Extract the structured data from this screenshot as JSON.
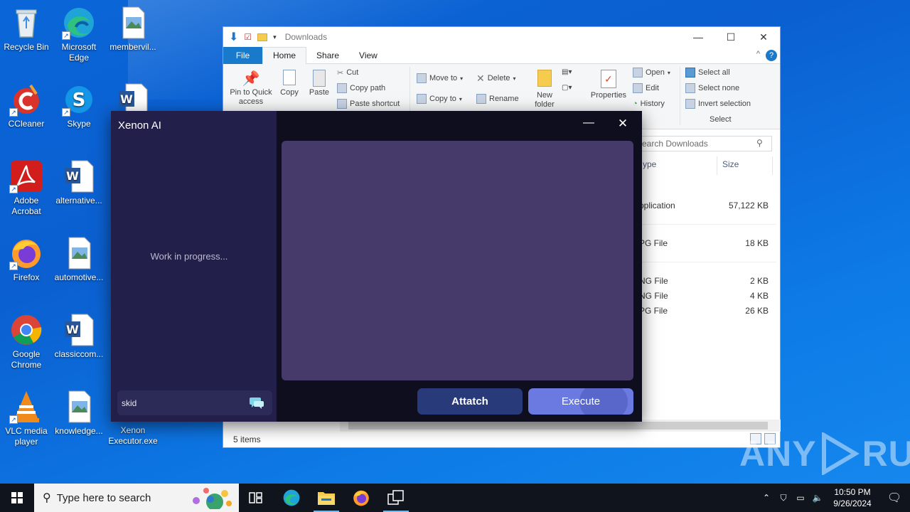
{
  "desktop": {
    "icons": [
      {
        "label": "Recycle Bin",
        "icon": "recycle-bin-icon"
      },
      {
        "label": "Microsoft Edge",
        "icon": "edge-icon"
      },
      {
        "label": "membervil...",
        "icon": "image-file-icon"
      },
      {
        "label": "CCleaner",
        "icon": "ccleaner-icon"
      },
      {
        "label": "Skype",
        "icon": "skype-icon"
      },
      {
        "label": "Adobe Acrobat",
        "icon": "acrobat-icon"
      },
      {
        "label": "alternative...",
        "icon": "word-doc-icon"
      },
      {
        "label": "Firefox",
        "icon": "firefox-icon"
      },
      {
        "label": "automotive...",
        "icon": "image-file-icon"
      },
      {
        "label": "Google Chrome",
        "icon": "chrome-icon"
      },
      {
        "label": "classiccom...",
        "icon": "word-doc-icon"
      },
      {
        "label": "VLC media player",
        "icon": "vlc-icon"
      },
      {
        "label": "knowledge...",
        "icon": "image-file-icon"
      },
      {
        "label": "Xenon Executor.exe",
        "icon": "exe-icon"
      }
    ]
  },
  "explorer": {
    "title": "Downloads",
    "tabs": {
      "file": "File",
      "home": "Home",
      "share": "Share",
      "view": "View"
    },
    "ribbon": {
      "pin": "Pin to Quick access",
      "copy": "Copy",
      "paste": "Paste",
      "cut": "Cut",
      "copy_path": "Copy path",
      "paste_shortcut": "Paste shortcut",
      "move_to": "Move to",
      "copy_to": "Copy to",
      "delete": "Delete",
      "rename": "Rename",
      "new_folder": "New folder",
      "properties": "Properties",
      "open": "Open",
      "edit": "Edit",
      "history": "History",
      "select_all": "Select all",
      "select_none": "Select none",
      "invert_selection": "Invert selection",
      "select_group": "Select"
    },
    "search_placeholder": "earch Downloads",
    "columns": {
      "type": "ype",
      "size": "Size"
    },
    "files": [
      {
        "type": "pplication",
        "size": "57,122 KB"
      },
      {
        "type": "PG File",
        "size": "18 KB"
      },
      {
        "type": "NG File",
        "size": "2 KB"
      },
      {
        "type": "NG File",
        "size": "4 KB"
      },
      {
        "type": "PG File",
        "size": "26 KB"
      }
    ],
    "status": "5 items"
  },
  "xenon": {
    "title": "Xenon AI",
    "wip": "Work in progress...",
    "username": "skid",
    "attach": "Attatch",
    "execute": "Execute",
    "min": "—",
    "close": "✕"
  },
  "watermark": {
    "left": "ANY",
    "right": "RUN"
  },
  "taskbar": {
    "search_placeholder": "Type here to search",
    "time": "10:50 PM",
    "date": "9/26/2024"
  }
}
